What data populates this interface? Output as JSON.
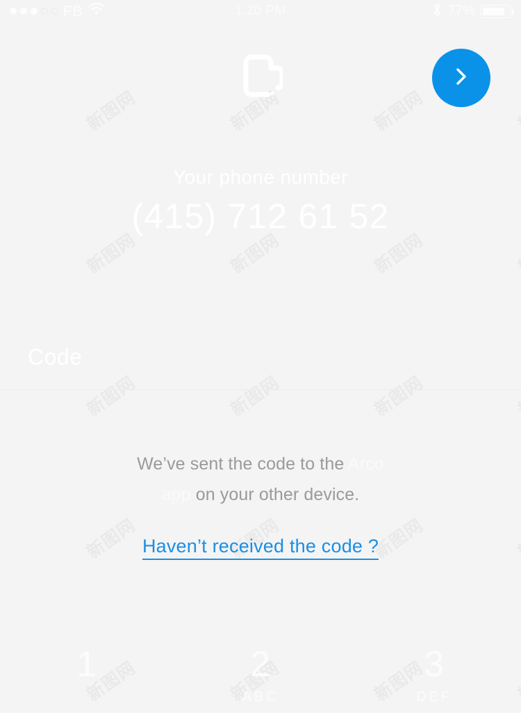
{
  "status_bar": {
    "signal_dots_filled": 3,
    "signal_dots_total": 5,
    "carrier": "FB",
    "wifi_icon": "wifi-icon",
    "time": "1:20 PM",
    "bluetooth_icon": "bluetooth-icon",
    "battery_percent": "77%",
    "battery_level": 0.73
  },
  "header": {
    "logo_icon": "app-logo-icon",
    "next_icon": "chevron-right-icon",
    "accent_color": "#0a92e8"
  },
  "phone": {
    "label": "Your phone number",
    "value": "(415) 712 61 52"
  },
  "code_field": {
    "placeholder": "Code",
    "value": ""
  },
  "info": {
    "line_before": "We’ve sent the code to the ",
    "app_name": "Arco app",
    "line_after": " on your other device."
  },
  "resend": {
    "label": "Haven’t received the code ?",
    "color": "#1a8fe3"
  },
  "keypad": [
    {
      "digit": "1",
      "letters": ""
    },
    {
      "digit": "2",
      "letters": "ABC"
    },
    {
      "digit": "3",
      "letters": "DEF"
    }
  ],
  "watermark": {
    "text": "新图网"
  },
  "theme": {
    "background": "#f4f4f4",
    "text_white": "#ffffff",
    "text_gray": "#9a9a9a",
    "divider": "#ececec"
  }
}
